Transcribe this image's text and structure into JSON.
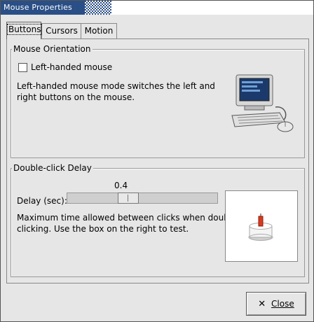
{
  "window": {
    "title": "Mouse Properties"
  },
  "tabs": [
    {
      "label": "Buttons",
      "active": true
    },
    {
      "label": "Cursors",
      "active": false
    },
    {
      "label": "Motion",
      "active": false
    }
  ],
  "orientation": {
    "heading": "Mouse Orientation",
    "checkbox_label": "Left-handed mouse",
    "checked": false,
    "description_line1": "Left-handed mouse mode switches the left and",
    "description_line2": "right buttons on the mouse.",
    "image_icon": "computer-with-mouse-icon"
  },
  "double_click": {
    "heading": "Double-click Delay",
    "delay_label": "Delay (sec):",
    "delay_value": "0.4",
    "slider_fraction": 0.39,
    "description_line1": "Maximum time allowed between clicks when double-",
    "description_line2": "clicking.  Use the box on the right to test.",
    "test_icon": "unlit-candle-icon"
  },
  "buttons": {
    "close_label": "Close"
  },
  "colors": {
    "titlebar": "#2a4f86"
  }
}
